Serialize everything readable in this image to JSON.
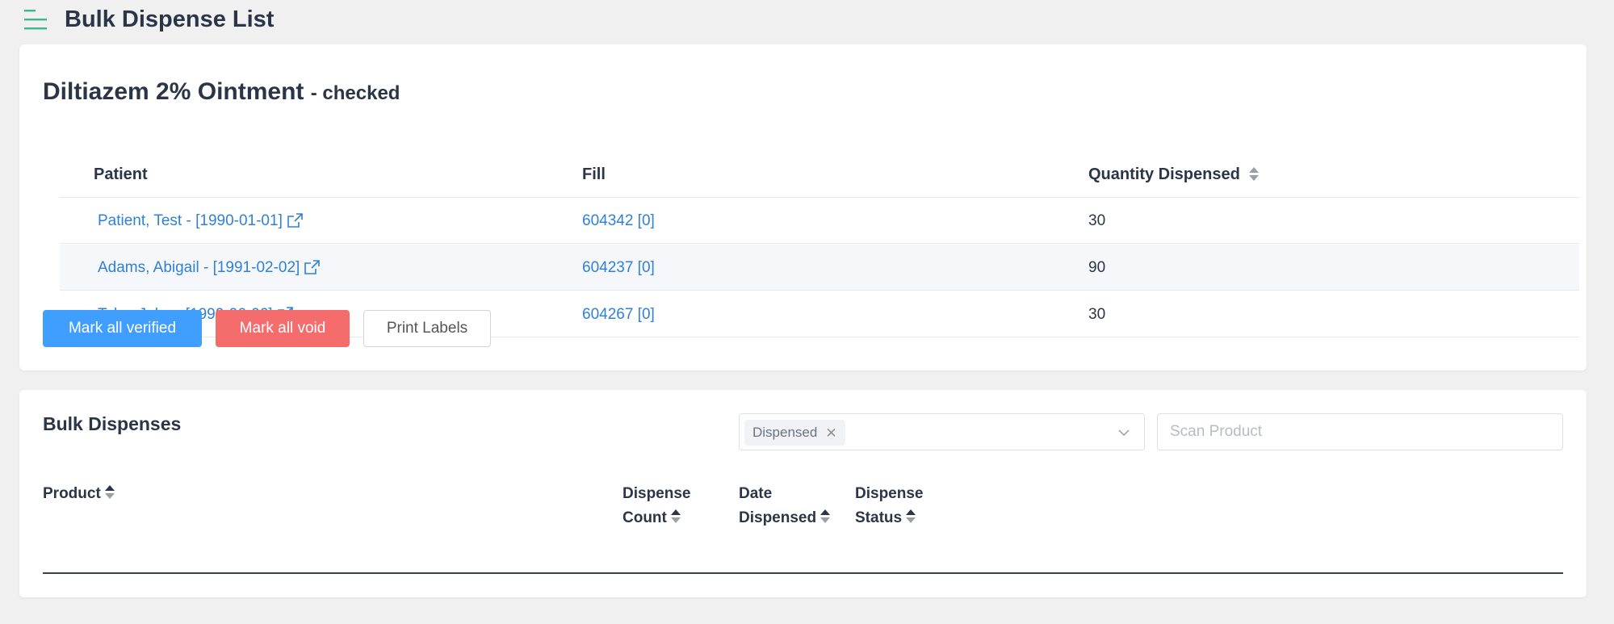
{
  "header": {
    "title": "Bulk Dispense List",
    "menu_icon": "hamburger-menu-icon",
    "accent_color": "#3fb68b"
  },
  "drug_card": {
    "drug_name": "Diltiazem 2% Ointment",
    "status": "- checked",
    "columns": {
      "patient": "Patient",
      "fill": "Fill",
      "quantity": "Quantity Dispensed"
    },
    "rows": [
      {
        "patient": "Patient, Test -  [1990-01-01]",
        "fill": "604342 [0]",
        "quantity": "30"
      },
      {
        "patient": "Adams, Abigail -  [1991-02-02]",
        "fill": "604237 [0]",
        "quantity": "90"
      },
      {
        "patient": "Tyler, John -  [1990-06-06]",
        "fill": "604267 [0]",
        "quantity": "30"
      }
    ],
    "buttons": {
      "verify": "Mark all verified",
      "void": "Mark all void",
      "print": "Print Labels"
    },
    "colors": {
      "link": "#2f80d8",
      "verify": "#409eff",
      "void": "#f56c6c"
    }
  },
  "bulk_dispenses": {
    "title": "Bulk Dispenses",
    "status_filter": {
      "selected_tag": "Dispensed"
    },
    "scan": {
      "placeholder": "Scan Product",
      "value": ""
    },
    "columns": {
      "product": "Product",
      "count_line1": "Dispense",
      "count_line2": "Count",
      "date_line1": "Date",
      "date_line2": "Dispensed",
      "status_line1": "Dispense",
      "status_line2": "Status"
    }
  }
}
